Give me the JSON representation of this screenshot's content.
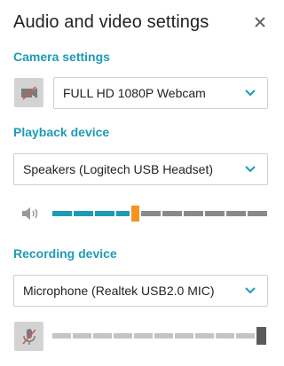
{
  "dialog": {
    "title": "Audio and video settings",
    "close_icon": "close-icon"
  },
  "camera": {
    "label": "Camera settings",
    "selected": "FULL HD 1080P Webcam",
    "icon": "camera-off-icon"
  },
  "playback": {
    "label": "Playback device",
    "selected": "Speakers (Logitech USB Headset)",
    "icon": "speaker-icon",
    "volume_level": 0.45
  },
  "recording": {
    "label": "Recording device",
    "selected": "Microphone (Realtek USB2.0 MIC)",
    "icon": "mic-off-icon",
    "level": 1.0
  },
  "colors": {
    "accent": "#1e9bb4",
    "knob_playback": "#f7931e",
    "muted_red": "#d9534f"
  }
}
